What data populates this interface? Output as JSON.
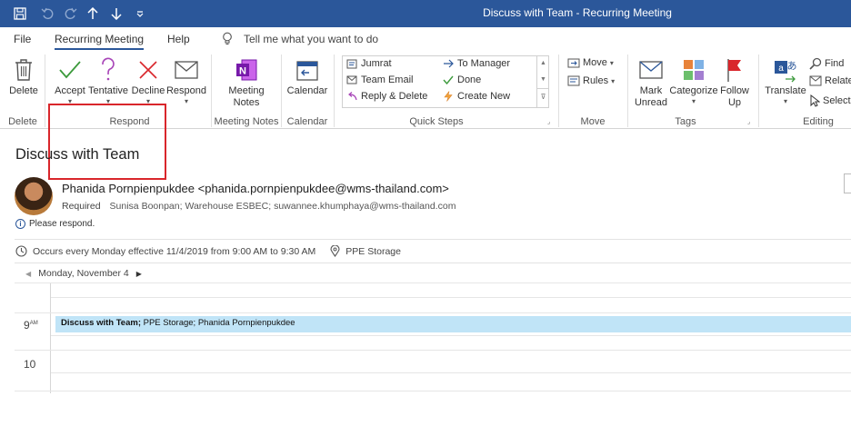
{
  "window": {
    "title": "Discuss with Team  -  Recurring Meeting"
  },
  "menu": {
    "items": [
      {
        "label": "File"
      },
      {
        "label": "Recurring Meeting"
      },
      {
        "label": "Help"
      }
    ],
    "tell_me": "Tell me what you want to do"
  },
  "ribbon": {
    "delete": {
      "button": "Delete",
      "group": "Delete"
    },
    "respond": {
      "accept": "Accept",
      "tentative": "Tentative",
      "decline": "Decline",
      "respond": "Respond",
      "group": "Respond"
    },
    "meeting_notes": {
      "line1": "Meeting",
      "line2": "Notes",
      "group": "Meeting Notes"
    },
    "calendar": {
      "button": "Calendar",
      "group": "Calendar"
    },
    "quick_steps": {
      "items": [
        "Jumrat",
        "Team Email",
        "Reply & Delete",
        "To Manager",
        "Done",
        "Create New"
      ],
      "group": "Quick Steps"
    },
    "move": {
      "move": "Move",
      "rules": "Rules",
      "group": "Move"
    },
    "tags": {
      "mark_unread_1": "Mark",
      "mark_unread_2": "Unread",
      "categorize": "Categorize",
      "follow_up_1": "Follow",
      "follow_up_2": "Up",
      "group": "Tags"
    },
    "editing": {
      "translate": "Translate",
      "find": "Find",
      "related": "Relate",
      "select": "Select",
      "group": "Editing"
    }
  },
  "meeting": {
    "subject": "Discuss with Team",
    "sender": "Phanida Pornpienpukdee <phanida.pornpienpukdee@wms-thailand.com>",
    "required_label": "Required",
    "required_attendees": "Sunisa Boonpan; Warehouse ESBEC; suwannee.khumphaya@wms-thailand.com",
    "info": "Please respond.",
    "recurrence": "Occurs every Monday effective 11/4/2019 from 9:00 AM to 9:30 AM",
    "location": "PPE Storage"
  },
  "calendar_preview": {
    "date": "Monday, November 4",
    "hour_9": "9",
    "hour_9_suffix": "AM",
    "hour_10": "10",
    "appointment_bold": "Discuss with Team;",
    "appointment_rest": " PPE Storage; Phanida Pornpienpukdee"
  },
  "colors": {
    "titlebar": "#2b579a",
    "highlight_box": "#d9262b",
    "appointment": "#c0e4f7",
    "accept": "#3c9a3c",
    "tentative": "#a845b8",
    "decline": "#d9262b"
  }
}
